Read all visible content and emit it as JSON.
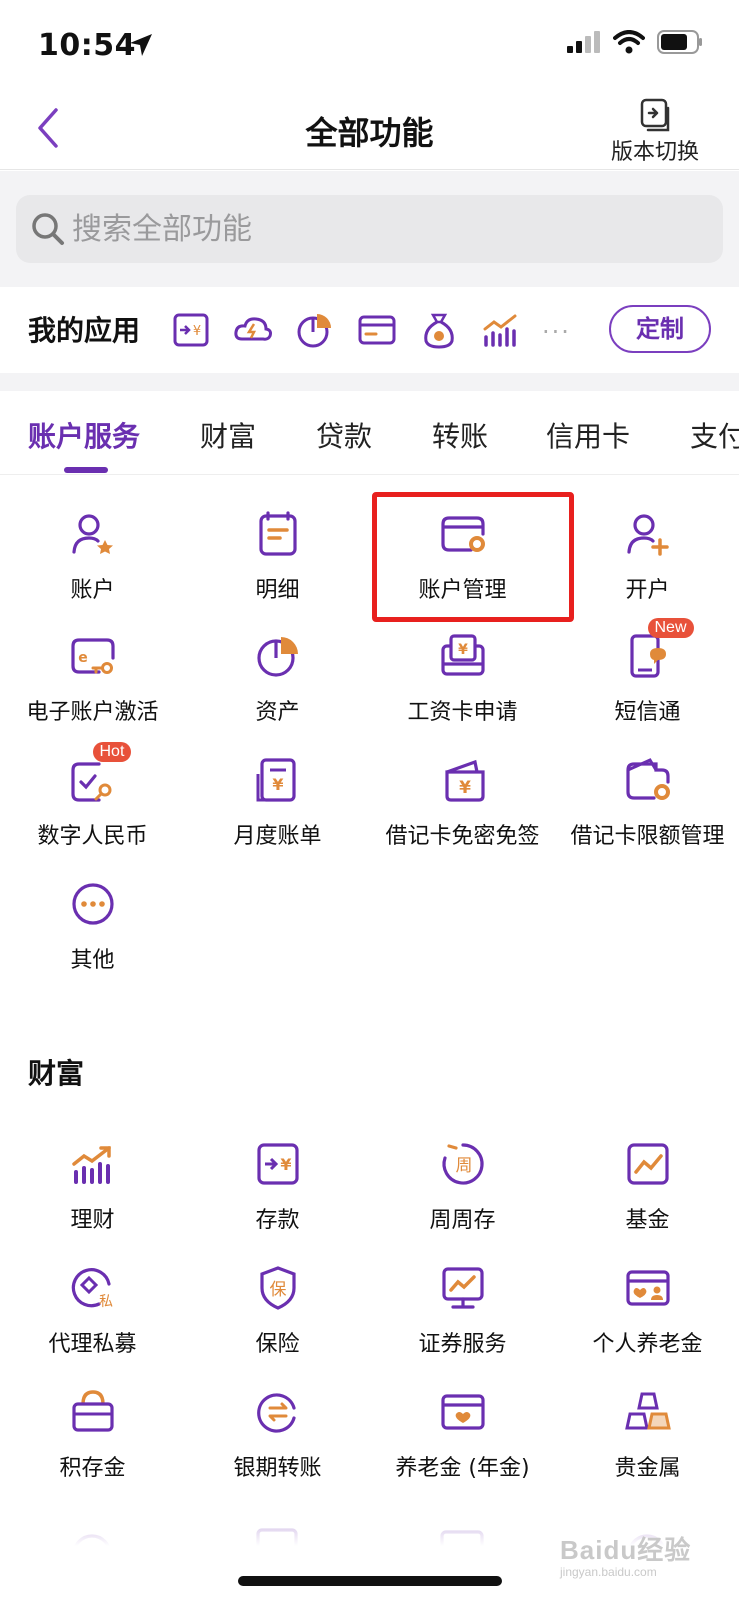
{
  "status": {
    "time": "10:54"
  },
  "nav": {
    "title": "全部功能",
    "version_label": "版本切换"
  },
  "search": {
    "placeholder": "搜索全部功能"
  },
  "myapps": {
    "title": "我的应用",
    "more": "...",
    "custom_label": "定制"
  },
  "tabs": [
    "账户服务",
    "财富",
    "贷款",
    "转账",
    "信用卡",
    "支付"
  ],
  "account_services": {
    "items": [
      {
        "label": "账户",
        "icon": "user-star-icon"
      },
      {
        "label": "明细",
        "icon": "document-list-icon"
      },
      {
        "label": "账户管理",
        "icon": "card-gear-icon"
      },
      {
        "label": "开户",
        "icon": "user-add-icon"
      },
      {
        "label": "电子账户激活",
        "icon": "ecard-key-icon"
      },
      {
        "label": "资产",
        "icon": "pie-chart-icon"
      },
      {
        "label": "工资卡申请",
        "icon": "salary-card-icon"
      },
      {
        "label": "短信通",
        "icon": "sms-phone-icon",
        "badge": "New"
      },
      {
        "label": "数字人民币",
        "icon": "digital-rmb-icon",
        "badge": "Hot"
      },
      {
        "label": "月度账单",
        "icon": "monthly-bill-icon"
      },
      {
        "label": "借记卡免密免签",
        "icon": "debit-card-yuan-icon"
      },
      {
        "label": "借记卡限额管理",
        "icon": "wallet-gear-icon"
      },
      {
        "label": "其他",
        "icon": "more-dots-icon"
      }
    ]
  },
  "wealth": {
    "title": "财富",
    "items": [
      {
        "label": "理财",
        "icon": "growth-chart-icon"
      },
      {
        "label": "存款",
        "icon": "deposit-yuan-icon"
      },
      {
        "label": "周周存",
        "icon": "weekly-save-icon",
        "glyph": "周"
      },
      {
        "label": "基金",
        "icon": "fund-chart-icon"
      },
      {
        "label": "代理私募",
        "icon": "private-fund-icon",
        "glyph": "私"
      },
      {
        "label": "保险",
        "icon": "insurance-shield-icon",
        "glyph": "保"
      },
      {
        "label": "证券服务",
        "icon": "securities-monitor-icon"
      },
      {
        "label": "个人养老金",
        "icon": "pension-card-icon"
      },
      {
        "label": "积存金",
        "icon": "gold-bag-icon"
      },
      {
        "label": "银期转账",
        "icon": "exchange-icon"
      },
      {
        "label": "养老金 (年金)",
        "icon": "annuity-card-icon"
      },
      {
        "label": "贵金属",
        "icon": "gold-bars-icon"
      }
    ]
  },
  "watermark": {
    "text": "Baidu经验",
    "sub": "jingyan.baidu.com"
  }
}
